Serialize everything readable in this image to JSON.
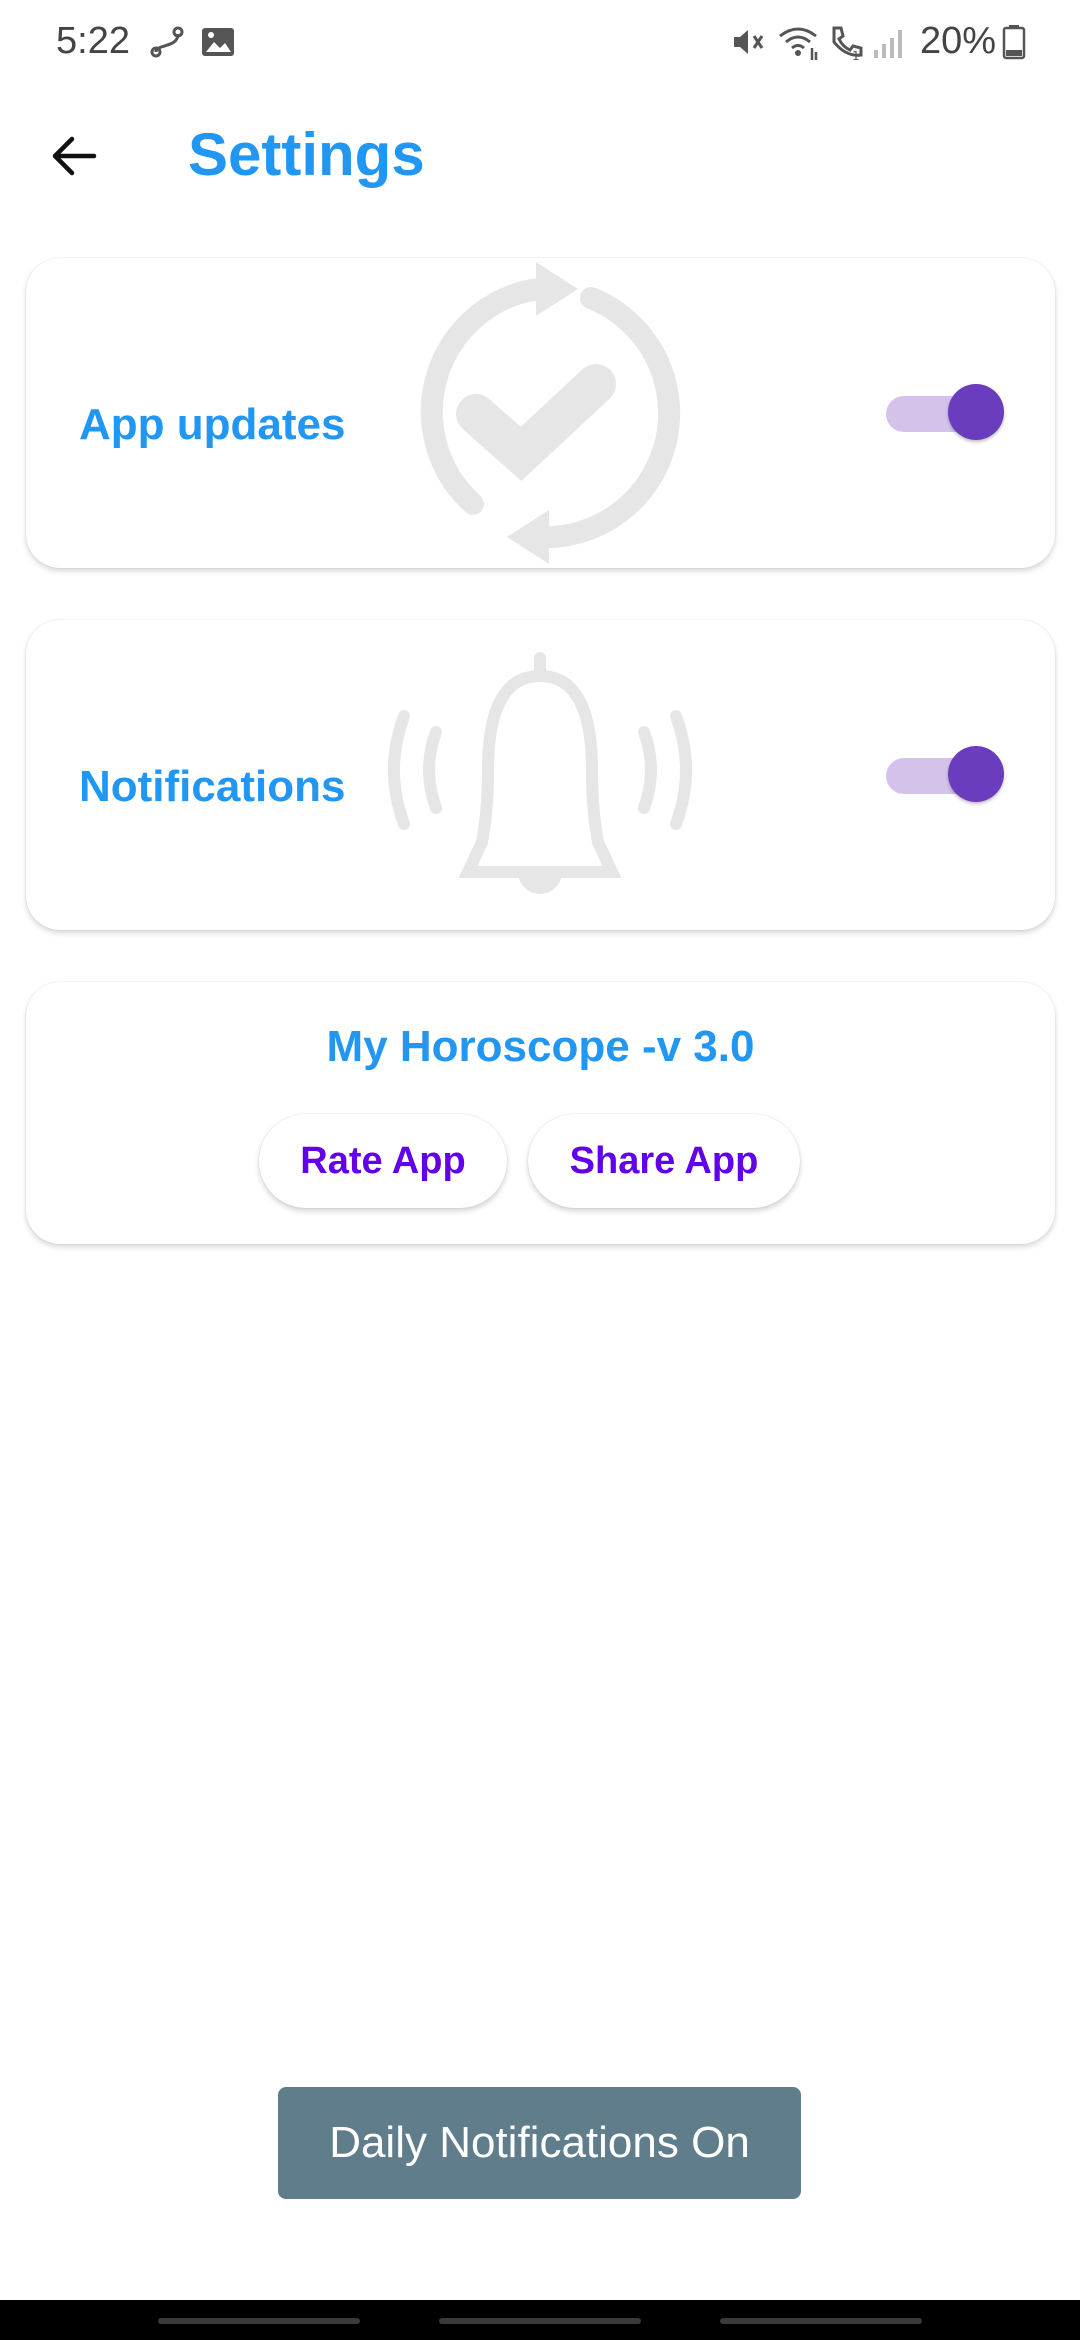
{
  "status_bar": {
    "time": "5:22",
    "battery": "20%",
    "icons": [
      "link-icon",
      "gallery-icon",
      "mute-icon",
      "wifi-icon",
      "call-icon",
      "signal-icon",
      "battery-icon"
    ]
  },
  "app_bar": {
    "title": "Settings",
    "back_icon": "arrow-left-icon"
  },
  "settings": {
    "app_updates": {
      "label": "App updates",
      "enabled": true,
      "background_icon": "sync-check-icon"
    },
    "notifications": {
      "label": "Notifications",
      "enabled": true,
      "background_icon": "ringing-bell-icon"
    }
  },
  "about": {
    "title": "My Horoscope -v 3.0",
    "rate_label": "Rate App",
    "share_label": "Share App"
  },
  "toast": {
    "message": "Daily Notifications On"
  },
  "colors": {
    "accent": "#2196F3",
    "button_text": "#6200EA",
    "switch_thumb": "#6A3CBE",
    "switch_track": "#D3C3EA",
    "toast_bg": "#607D8B"
  }
}
